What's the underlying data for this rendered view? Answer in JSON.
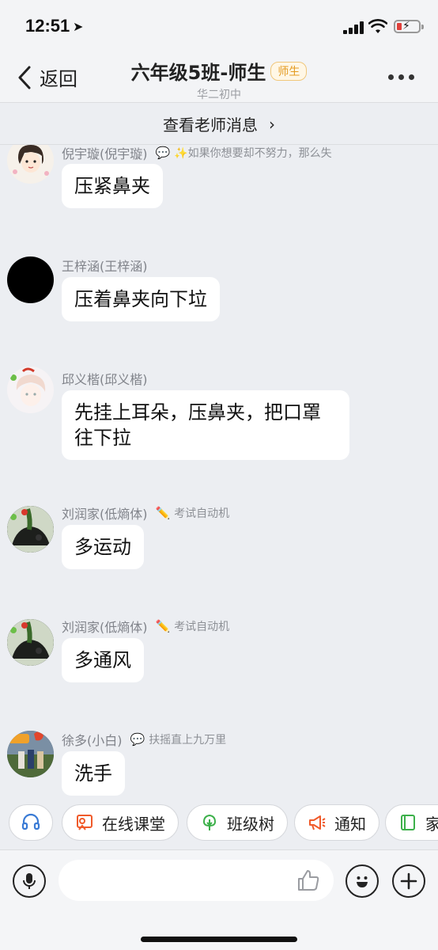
{
  "status_bar": {
    "time": "12:51",
    "location_arrow": "➤"
  },
  "nav": {
    "back_label": "返回",
    "title": "六年级5班-师生",
    "badge": "师生",
    "subtitle": "华二初中"
  },
  "teacher_bar": {
    "label": "查看老师消息",
    "chevron": "›"
  },
  "messages": [
    {
      "sender": "倪宇璇(倪宇璇)",
      "tag_icon": "💬",
      "tag": "✨如果你想要却不努力，那么失",
      "text": "压紧鼻夹"
    },
    {
      "sender": "王梓涵(王梓涵)",
      "tag_icon": "",
      "tag": "",
      "text": "压着鼻夹向下垃"
    },
    {
      "sender": "邱义楷(邱义楷)",
      "tag_icon": "",
      "tag": "",
      "text_line1": "先挂上耳朵，压鼻夹，把口罩",
      "text_line2": "往下拉"
    },
    {
      "sender": "刘润家(低熵体)",
      "tag_icon": "✏️",
      "tag": "考试自动机",
      "text": "多运动"
    },
    {
      "sender": "刘润家(低熵体)",
      "tag_icon": "✏️",
      "tag": "考试自动机",
      "text": "多通风"
    },
    {
      "sender": "徐多(小白)",
      "tag_icon": "💬",
      "tag": "扶摇直上九万里",
      "text": "洗手"
    }
  ],
  "quick_actions": [
    {
      "label": "",
      "icon": "headset-icon"
    },
    {
      "label": "在线课堂",
      "icon": "online-class-icon"
    },
    {
      "label": "班级树",
      "icon": "tree-icon"
    },
    {
      "label": "通知",
      "icon": "megaphone-icon"
    },
    {
      "label": "家",
      "icon": "notebook-icon"
    }
  ],
  "input": {
    "placeholder": ""
  },
  "colors": {
    "online_class": "#f05a2a",
    "tree": "#3cb04a",
    "notice": "#f05a2a",
    "homework": "#3cb04a",
    "headset": "#3a7bd5",
    "badge": "#e49b21"
  }
}
